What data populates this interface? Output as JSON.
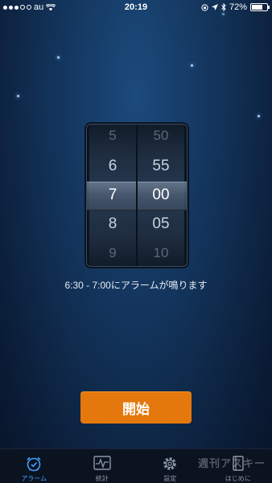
{
  "status": {
    "carrier": "au",
    "time": "20:19",
    "battery": "72%"
  },
  "picker": {
    "hours": [
      "5",
      "6",
      "7",
      "8",
      "9"
    ],
    "minutes": [
      "50",
      "55",
      "00",
      "05",
      "10"
    ]
  },
  "message": "6:30 - 7:00にアラームが鳴ります",
  "start_label": "開始",
  "tabs": [
    {
      "label": "アラーム",
      "icon": "alarm-clock-icon"
    },
    {
      "label": "統計",
      "icon": "stats-graph-icon"
    },
    {
      "label": "設定",
      "icon": "gear-icon"
    },
    {
      "label": "はじめに",
      "icon": "book-icon"
    }
  ],
  "watermark": "週刊アスキー",
  "colors": {
    "accent": "#e4780c",
    "tab_active": "#3fa0ff"
  }
}
